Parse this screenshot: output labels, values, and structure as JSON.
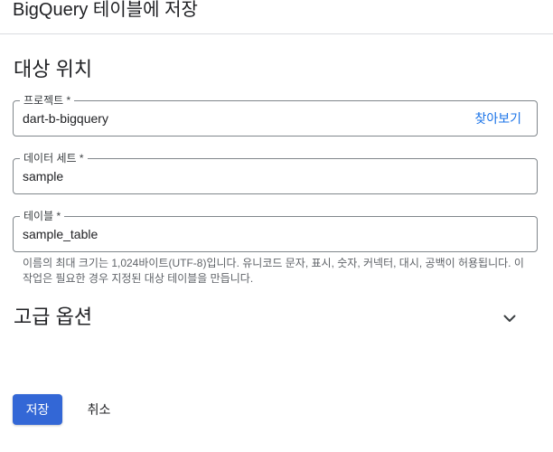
{
  "dialog": {
    "title": "BigQuery 테이블에 저장"
  },
  "destination": {
    "section_title": "대상 위치",
    "project": {
      "label": "프로젝트 *",
      "value": "dart-b-bigquery",
      "browse_label": "찾아보기"
    },
    "dataset": {
      "label": "데이터 세트 *",
      "value": "sample"
    },
    "table": {
      "label": "테이블 *",
      "value": "sample_table",
      "hint": "이름의 최대 크기는 1,024바이트(UTF-8)입니다. 유니코드 문자, 표시, 숫자, 커넥터, 대시, 공백이 허용됩니다. 이 작업은 필요한 경우 지정된 대상 테이블을 만듭니다."
    }
  },
  "advanced": {
    "title": "고급 옵션",
    "icon": "chevron-down-icon"
  },
  "actions": {
    "save_label": "저장",
    "cancel_label": "취소"
  },
  "colors": {
    "primary": "#3367d6",
    "link": "#1a73e8",
    "border": "#80868b",
    "divider": "#dadce0",
    "hint_text": "#5f6368"
  }
}
